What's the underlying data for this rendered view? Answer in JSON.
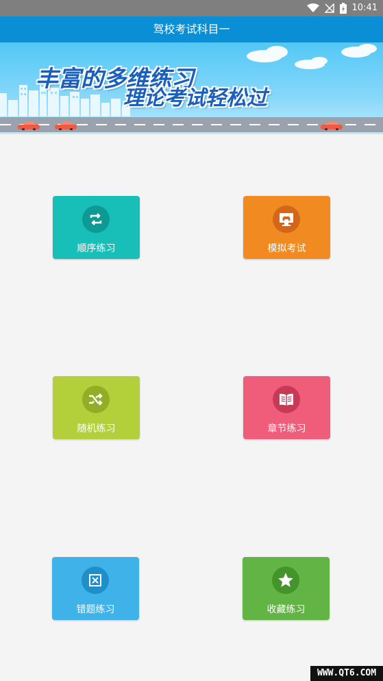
{
  "status_bar": {
    "time": "10:41"
  },
  "app_bar": {
    "title": "驾校考试科目一"
  },
  "banner": {
    "line1": "丰富的多维练习",
    "line2": "理论考试轻松过"
  },
  "menu": [
    {
      "label": "顺序练习",
      "color": "#17bfb8",
      "circle": "#0e9a94",
      "icon": "repeat-icon"
    },
    {
      "label": "模拟考试",
      "color": "#f28a22",
      "circle": "#d4661a",
      "icon": "monitor-car-icon"
    },
    {
      "label": "随机练习",
      "color": "#b3cf3a",
      "circle": "#93ad25",
      "icon": "shuffle-icon"
    },
    {
      "label": "章节练习",
      "color": "#ef5d7a",
      "circle": "#c73a56",
      "icon": "book-icon"
    },
    {
      "label": "错题练习",
      "color": "#3fb2ea",
      "circle": "#1e8fc9",
      "icon": "close-box-icon"
    },
    {
      "label": "收藏练习",
      "color": "#62b545",
      "circle": "#43942a",
      "icon": "star-icon"
    }
  ],
  "watermark": "WWW.QT6.COM"
}
